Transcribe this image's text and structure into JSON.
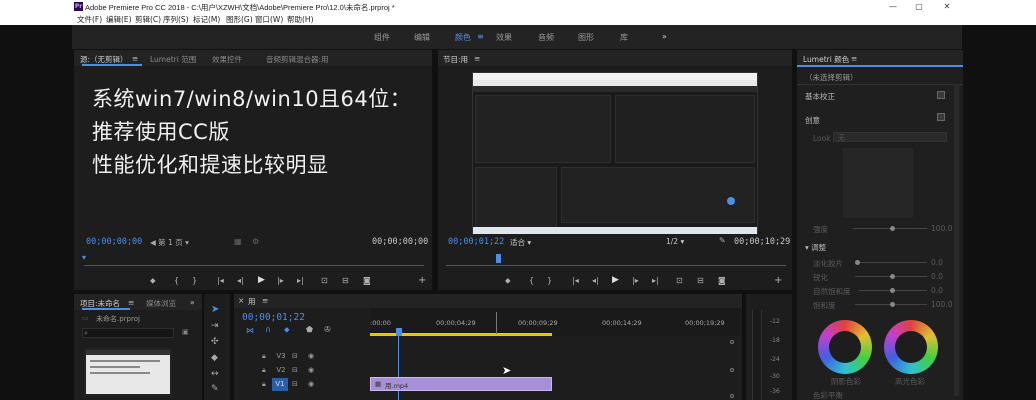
{
  "window": {
    "title": "Adobe Premiere Pro CC 2018 - C:\\用户\\XZWH\\文档\\Adobe\\Premiere Pro\\12.0\\未命名.prproj *",
    "app_icon": "Pr"
  },
  "menu": [
    "文件(F)",
    "编辑(E)",
    "剪辑(C)",
    "序列(S)",
    "标记(M)",
    "图形(G)",
    "窗口(W)",
    "帮助(H)"
  ],
  "workspaces": [
    "组件",
    "编辑",
    "颜色",
    "效果",
    "音频",
    "图形",
    "库"
  ],
  "workspace_active": "颜色",
  "workspace_more": "»",
  "source_panel": {
    "tabs": [
      "源:（无剪辑）",
      "Lumetri 范围",
      "效果控件",
      "音频剪辑混合器:用"
    ],
    "menu_glyph": "≡",
    "overlay_lines": [
      "系统win7/win8/win10且64位：",
      "推荐使用CC版",
      "性能优化和提速比较明显"
    ],
    "timecode_left": "00;00;00;00",
    "page_select": "第 1 页",
    "timecode_right": "00;00;00;00"
  },
  "program_panel": {
    "title": "节目:用",
    "menu_glyph": "≡",
    "timecode_left": "00;00;01;22",
    "fit_select": "适合",
    "resolution_select": "1/2",
    "timecode_right": "00;00;10;29"
  },
  "project_panel": {
    "tabs": [
      "项目:未命名",
      "媒体浏览"
    ],
    "more": "»",
    "project_file": "未命名.prproj"
  },
  "timeline": {
    "close": "×",
    "title": "用",
    "menu_glyph": "≡",
    "timecode": "00;00;01;22",
    "ruler_labels": [
      ":00;00",
      "00;00;04;29",
      "00;00;09;29",
      "00;00;14;29",
      "00;00;19;29"
    ],
    "tracks": [
      "V3",
      "V2",
      "V1"
    ],
    "clip_label": "用.mp4"
  },
  "meter": {
    "labels": [
      "-12",
      "-18",
      "-24",
      "-30",
      "-36"
    ]
  },
  "lumetri": {
    "title": "Lumetri 颜色",
    "menu_glyph": "≡",
    "clip_select": "（未选择剪辑）",
    "sections": [
      "基本校正",
      "创意"
    ],
    "look_label": "Look",
    "look_value": "无",
    "intensity_label": "强度",
    "intensity_value": "100.0",
    "adjust_label": "调整",
    "adjust_rows": [
      {
        "label": "淡化胶片",
        "value": "0.0"
      },
      {
        "label": "锐化",
        "value": "0.0"
      },
      {
        "label": "自然饱和度",
        "value": "0.0"
      },
      {
        "label": "饱和度",
        "value": "100.0"
      }
    ],
    "wheel_labels": [
      "阴影色彩",
      "高光色彩"
    ],
    "tint_label": "色彩平衡"
  }
}
